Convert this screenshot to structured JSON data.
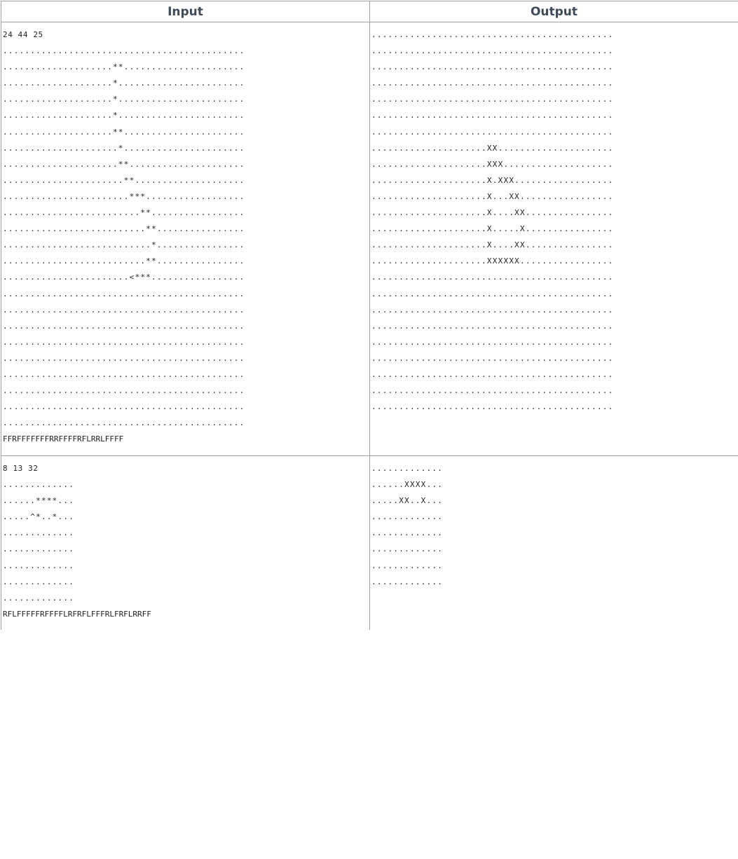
{
  "headers": {
    "input": "Input",
    "output": "Output"
  },
  "examples": [
    {
      "input": {
        "first_line": "24 44 25",
        "grid": [
          "............................................",
          "....................**......................",
          "....................*.......................",
          "....................*.......................",
          "....................*.......................",
          "....................**......................",
          ".....................*......................",
          ".....................**.....................",
          "......................**....................",
          ".......................***..................",
          ".........................**.................",
          "..........................**................",
          "...........................*................",
          "..........................**................",
          ".......................<***.................",
          "............................................",
          "............................................",
          "............................................",
          "............................................",
          "............................................",
          "............................................",
          "............................................",
          "............................................",
          "............................................"
        ],
        "commands": "FFRFFFFFFFRRFFFFRFLRRLFFFF"
      },
      "output": {
        "grid": [
          "............................................",
          "............................................",
          "............................................",
          "............................................",
          "............................................",
          "............................................",
          "............................................",
          ".....................XX.....................",
          ".....................XXX....................",
          ".....................X.XXX..................",
          ".....................X...XX.................",
          ".....................X....XX................",
          ".....................X.....X................",
          ".....................X....XX................",
          ".....................XXXXXX.................",
          "............................................",
          "............................................",
          "............................................",
          "............................................",
          "............................................",
          "............................................",
          "............................................",
          "............................................",
          "............................................"
        ]
      }
    },
    {
      "input": {
        "first_line": "8 13 32",
        "grid": [
          ".............",
          "......****...",
          ".....^*..*...",
          ".............",
          ".............",
          ".............",
          ".............",
          "............."
        ],
        "commands": "RFLFFFFFRFFFFLRFRFLFFFRLFRFLRRFF"
      },
      "output": {
        "grid": [
          ".............",
          "......XXXX...",
          ".....XX..X...",
          ".............",
          ".............",
          ".............",
          ".............",
          "............."
        ]
      }
    }
  ]
}
